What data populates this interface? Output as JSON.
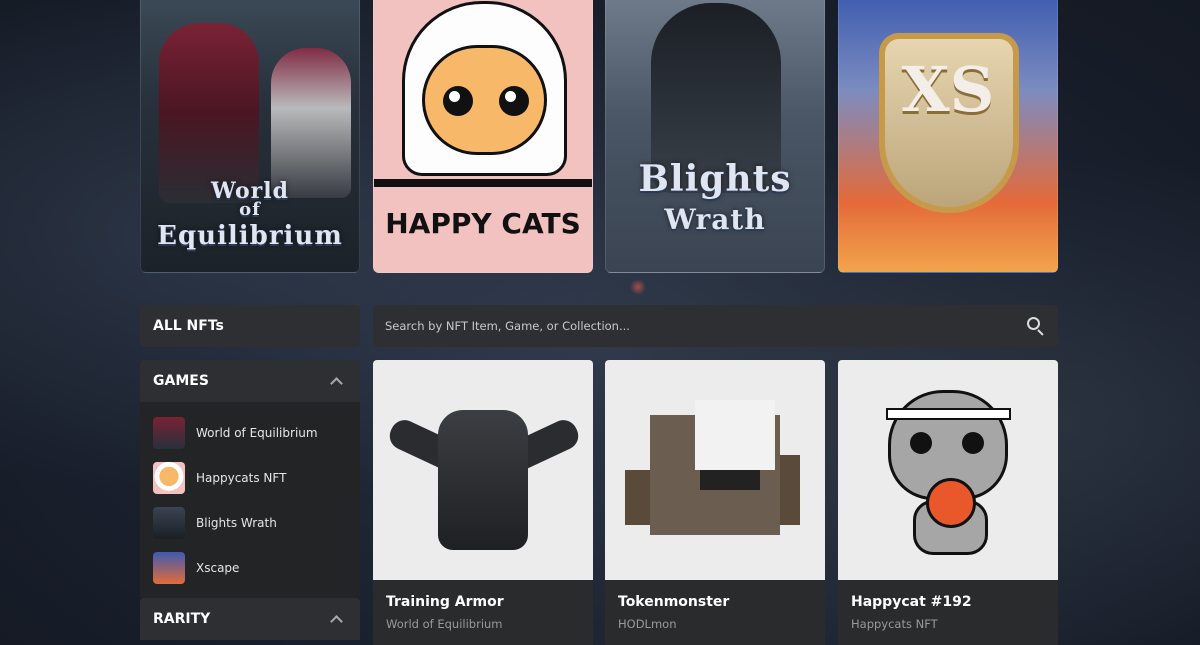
{
  "banners": [
    {
      "id": "woe",
      "title_lines": [
        "World",
        "of",
        "Equilibrium"
      ]
    },
    {
      "id": "happycats",
      "title": "HAPPY CATS"
    },
    {
      "id": "blights",
      "title_lines": [
        "Blights",
        "Wrath"
      ]
    },
    {
      "id": "xscape",
      "title": "XS"
    }
  ],
  "filters": {
    "all_nfts_label": "ALL NFTs",
    "games_header": "GAMES",
    "games": [
      {
        "label": "World of Equilibrium"
      },
      {
        "label": "Happycats NFT"
      },
      {
        "label": "Blights Wrath"
      },
      {
        "label": "Xscape"
      }
    ],
    "rarity_header": "RARITY"
  },
  "search": {
    "placeholder": "Search by NFT Item, Game, or Collection..."
  },
  "nfts": [
    {
      "name": "Training Armor",
      "game": "World of Equilibrium"
    },
    {
      "name": "Tokenmonster",
      "game": "HODLmon"
    },
    {
      "name": "Happycat #192",
      "game": "Happycats NFT"
    }
  ]
}
